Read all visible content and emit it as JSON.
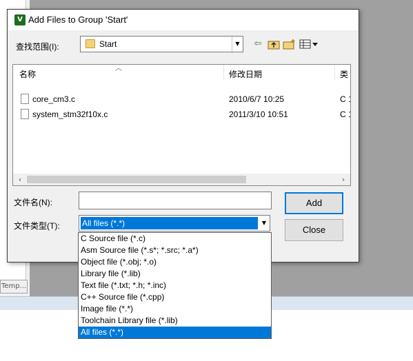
{
  "background": {
    "panel_label": "Temp..."
  },
  "dialog": {
    "title": "Add Files to Group 'Start'",
    "icon": "uvision-app-icon",
    "lookin_label": "查找范围(I):",
    "lookin_value": "Start",
    "toolbar": [
      "back-icon",
      "up-folder-icon",
      "new-folder-icon",
      "view-menu-icon"
    ],
    "columns": [
      "名称",
      "修改日期",
      "类"
    ],
    "files": [
      {
        "name": "core_cm3.c",
        "date": "2010/6/7 10:25",
        "type": "C 1"
      },
      {
        "name": "system_stm32f10x.c",
        "date": "2011/3/10 10:51",
        "type": "C 1"
      }
    ],
    "filename_label": "文件名(N):",
    "filename_value": "",
    "filetype_label": "文件类型(T):",
    "filetype_value": "All files (*.*)",
    "add_label": "Add",
    "close_label": "Close"
  },
  "dropdown": {
    "options": [
      "C Source file (*.c)",
      "Asm Source file (*.s*; *.src; *.a*)",
      "Object file (*.obj; *.o)",
      "Library file (*.lib)",
      "Text file (*.txt; *.h; *.inc)",
      "C++ Source file (*.cpp)",
      "Image file (*.*)",
      "Toolchain Library file (*.lib)",
      "All files (*.*)"
    ],
    "selected_index": 8
  },
  "colors": {
    "selection": "#0078d7",
    "dialog_bg": "#f0f0f0",
    "workspace_bg": "#a0a0a0"
  }
}
